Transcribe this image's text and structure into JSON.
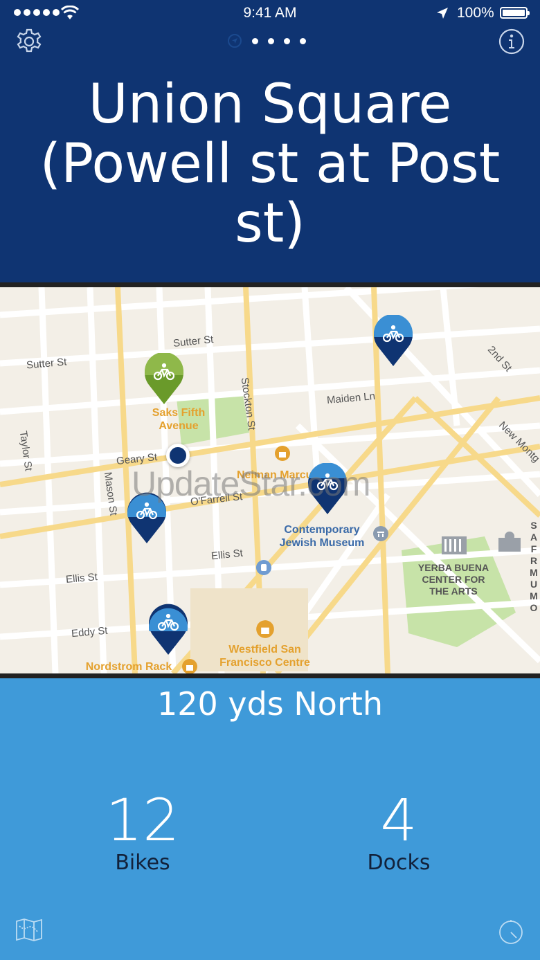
{
  "status_bar": {
    "time": "9:41 AM",
    "battery": "100%"
  },
  "header": {
    "station_name": "Union Square (Powell st at Post st)",
    "pager_count": 4
  },
  "map": {
    "streets": [
      "Sutter St",
      "Sutter St",
      "Maiden Ln",
      "2nd St",
      "Taylor St",
      "Stockton St",
      "Geary St",
      "Mason St",
      "O'Farrell St",
      "New Montg",
      "Ellis St",
      "Ellis St",
      "Eddy St"
    ],
    "places": {
      "saks": "Saks Fifth Avenue",
      "neiman": "Neiman Marcus",
      "museum": "Contemporary Jewish Museum",
      "yerba": "YERBA BUENA CENTER FOR THE ARTS",
      "sfmoma": "SA FR MU MO",
      "westfield": "Westfield San Francisco Centre",
      "nordstrom": "Nordstrom Rack"
    },
    "watermark": "UpdateStar.com",
    "colors": {
      "water": "#f3efe7",
      "park": "#c7e3a8",
      "road": "#ffffff",
      "major_road": "#f7d98a"
    }
  },
  "panel": {
    "direction": "120 yds North",
    "bikes_count": "12",
    "bikes_label": "Bikes",
    "docks_count": "4",
    "docks_label": "Docks"
  },
  "icons": {
    "settings": "gear-icon",
    "info": "info-icon",
    "map_toggle": "map-icon",
    "timer": "timer-icon",
    "bike": "bike-icon"
  },
  "colors": {
    "header_bg": "#0f3472",
    "panel_bg": "#3f9ad9",
    "pin_blue": "#3a8fd4",
    "pin_navy": "#0f3472",
    "pin_green": "#8fb84a"
  }
}
